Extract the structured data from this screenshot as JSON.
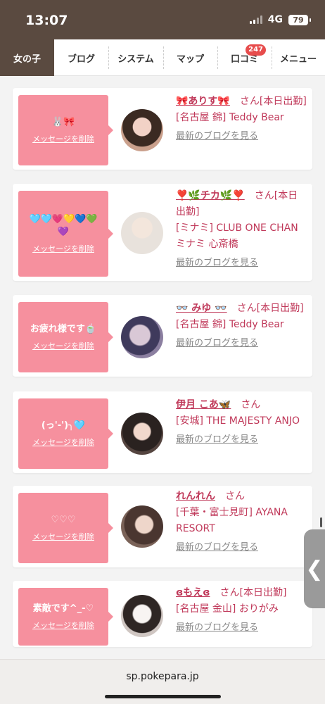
{
  "status": {
    "time": "13:07",
    "network": "4G",
    "battery": "79"
  },
  "nav": {
    "tabs": [
      {
        "label": "女の子"
      },
      {
        "label": "ブログ"
      },
      {
        "label": "システム"
      },
      {
        "label": "マップ"
      },
      {
        "label": "口コミ",
        "badge": "247"
      },
      {
        "label": "メニュー"
      }
    ]
  },
  "cards": [
    {
      "message": "🐰🎀",
      "delete_label": "メッセージを削除",
      "name": "🎀ありす🎀",
      "san": "さん",
      "status": "[本日出勤]",
      "shop": "[名古屋 錦] Teddy Bear",
      "blog_link": "最新のブログを見る"
    },
    {
      "message": "🩵🩵💗💛💙💚💜",
      "delete_label": "メッセージを削除",
      "name": "❣️🌿チカ🌿❣️",
      "san": "さん",
      "status": "[本日出勤]",
      "shop": "[ミナミ] CLUB ONE CHAN ミナミ 心斎橋",
      "blog_link": "最新のブログを見る"
    },
    {
      "message": "お疲れ様です🍵",
      "delete_label": "メッセージを削除",
      "name": "👓 みゆ 👓",
      "san": "さん",
      "status": "[本日出勤]",
      "shop": "[名古屋 錦] Teddy Bear",
      "blog_link": "最新のブログを見る"
    },
    {
      "message": "(っ'-')╮🩵",
      "delete_label": "メッセージを削除",
      "name": "伊月 こあ🦋",
      "san": "さん",
      "status": "",
      "shop": "[安城] THE MAJESTY ANJO",
      "blog_link": "最新のブログを見る"
    },
    {
      "message": "♡♡♡",
      "delete_label": "メッセージを削除",
      "name": "れんれん",
      "san": "さん",
      "status": "",
      "shop": "[千葉・富士見町] AYANA RESORT",
      "blog_link": "最新のブログを見る"
    },
    {
      "message": "素敵です^_-♡",
      "delete_label": "メッセージを削除",
      "name": "ɞもえɞ",
      "san": "さん",
      "status": "[本日出勤]",
      "shop": "[名古屋 金山] おりがみ",
      "blog_link": "最新のブログを見る"
    }
  ],
  "side_tab": {
    "icon": "chevron-left-icon",
    "glyph": "❮"
  },
  "url_bar": {
    "url": "sp.pokepara.jp"
  },
  "colors": {
    "accent": "#c0395a",
    "bubble": "#f6909e",
    "header": "#5a4a40",
    "badge": "#e74c4c"
  }
}
